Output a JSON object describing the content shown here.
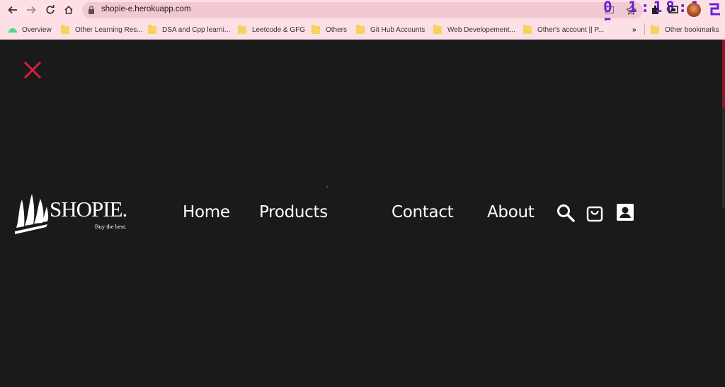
{
  "browser": {
    "url": "shopie-e.herokuapp.com",
    "clock_text": "0 1:18:1 5",
    "bookmarks": [
      {
        "label": "Overview",
        "icon": "android-icon"
      },
      {
        "label": "Other Learning Res...",
        "icon": "folder-icon"
      },
      {
        "label": "DSA and Cpp learni...",
        "icon": "folder-icon"
      },
      {
        "label": "Leetcode & GFG",
        "icon": "folder-icon"
      },
      {
        "label": "Others",
        "icon": "folder-icon"
      },
      {
        "label": "Git Hub Accounts",
        "icon": "folder-icon"
      },
      {
        "label": "Web Developement...",
        "icon": "folder-icon"
      },
      {
        "label": "Other's account || P...",
        "icon": "folder-icon"
      }
    ],
    "more_bookmarks": "»",
    "other_bookmarks": "Other bookmarks"
  },
  "site": {
    "brand": "SHOPIE.",
    "tagline": "Buy the best.",
    "nav": [
      "Home",
      "Products",
      "Contact",
      "About"
    ],
    "icons": [
      "search-icon",
      "cart-icon",
      "account-icon"
    ],
    "close_icon": "close-icon",
    "accent": "#d21f3c",
    "background": "#1b1a1b"
  }
}
